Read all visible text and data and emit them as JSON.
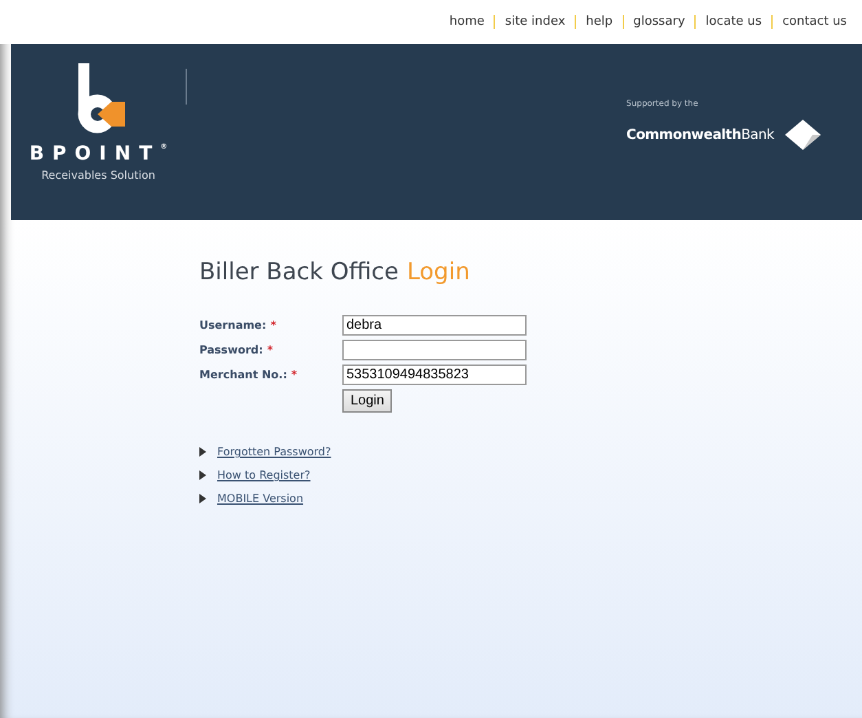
{
  "top_nav": [
    {
      "label": "home"
    },
    {
      "label": "site index"
    },
    {
      "label": "help"
    },
    {
      "label": "glossary"
    },
    {
      "label": "locate us"
    },
    {
      "label": "contact us"
    }
  ],
  "banner": {
    "brand": "BPOINT",
    "brand_mark": "®",
    "tagline": "Receivables Solution",
    "supported_by": "Supported by the",
    "bank_name": "**Commonwealth**Bank"
  },
  "login": {
    "title": "Biller Back Office",
    "title_accent": "Login",
    "fields": [
      {
        "label": "Username:",
        "required_mark": "*",
        "value": "debra"
      },
      {
        "label": "Password:",
        "required_mark": "*"
      },
      {
        "label": "Merchant No.:",
        "required_mark": "*",
        "value": "5353109494835823"
      }
    ],
    "button": "Login"
  },
  "links": [
    {
      "label": "Forgotten Password?"
    },
    {
      "label": "How to Register?"
    },
    {
      "label": "MOBILE Version"
    }
  ]
}
